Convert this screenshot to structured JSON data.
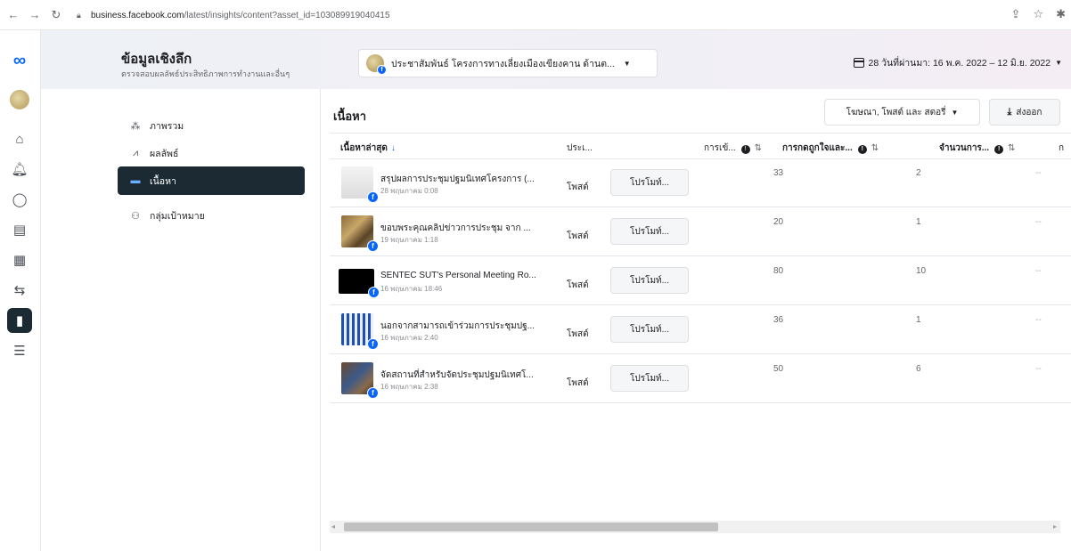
{
  "browser": {
    "url_domain": "business.facebook.com",
    "url_path": "/latest/insights/content?asset_id=103089919040415"
  },
  "header": {
    "title": "ข้อมูลเชิงลึก",
    "subtitle": "ตรวจสอบผลลัพธ์ประสิทธิภาพการทำงานและอื่นๆ",
    "page_selector": "ประชาสัมพันธ์ โครงการทางเลี่ยงเมืองเขียงคาน ด้านต...",
    "date_range": "28 วันที่ผ่านมา: 16 พ.ค. 2022 – 12 มิ.ย. 2022"
  },
  "sidebar": {
    "items": [
      {
        "label": "ภาพรวม",
        "icon": "overview-icon"
      },
      {
        "label": "ผลลัพธ์",
        "icon": "results-icon"
      },
      {
        "label": "เนื้อหา",
        "icon": "content-icon"
      },
      {
        "label": "กลุ่มเป้าหมาย",
        "icon": "audience-icon"
      }
    ]
  },
  "content": {
    "title": "เนื้อหา",
    "filter_label": "โฆษณา, โพสต์ และ สตอรี่",
    "export_label": "ส่งออก",
    "columns": {
      "content": "เนื้อหาล่าสุด",
      "type": "ประเ...",
      "reach": "การเข้...",
      "engagement": "การกดถูกใจและ...",
      "third": "จำนวนการ...",
      "fourth": "ก"
    },
    "rows": [
      {
        "title": "สรุปผลการประชุมปฐมนิเทศโครงการ (...",
        "date": "28 พฤษภาคม 0:08",
        "type": "โพสต์",
        "promote": "โปรโมท์...",
        "reach": "33",
        "engagement": "2",
        "third": "--"
      },
      {
        "title": "ขอบพระคุณคลิปข่าวการประชุม จาก ...",
        "date": "19 พฤษภาคม 1:18",
        "type": "โพสต์",
        "promote": "โปรโมท์...",
        "reach": "20",
        "engagement": "1",
        "third": "--"
      },
      {
        "title": "SENTEC SUT's Personal Meeting Ro...",
        "date": "16 พฤษภาคม 18:46",
        "type": "โพสต์",
        "promote": "โปรโมท์...",
        "reach": "80",
        "engagement": "10",
        "third": "--"
      },
      {
        "title": "นอกจากสามารถเข้าร่วมการประชุมปฐ...",
        "date": "16 พฤษภาคม 2:40",
        "type": "โพสต์",
        "promote": "โปรโมท์...",
        "reach": "36",
        "engagement": "1",
        "third": "--"
      },
      {
        "title": "จัดสถานที่สำหรับจัดประชุมปฐมนิเทศโ...",
        "date": "16 พฤษภาคม 2:38",
        "type": "โพสต์",
        "promote": "โปรโมท์...",
        "reach": "50",
        "engagement": "6",
        "third": "--"
      }
    ]
  },
  "colors": {
    "accent": "#0866ff",
    "active_nav": "#1c2b33"
  }
}
